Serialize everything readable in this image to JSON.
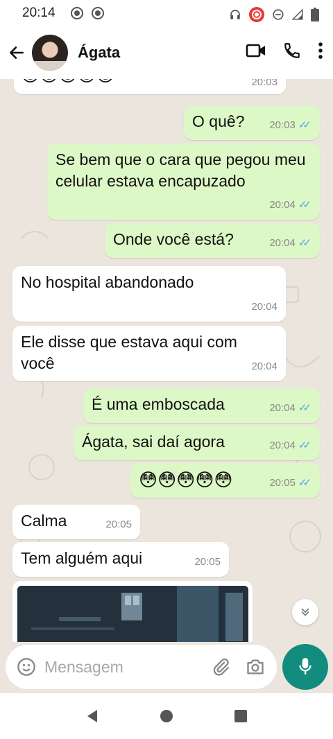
{
  "status_bar": {
    "time": "20:14",
    "left_icons": [
      "record-icon",
      "record-icon"
    ],
    "right_icons": [
      "headphones-icon",
      "recording-icon",
      "do-not-disturb-icon",
      "signal-icon",
      "battery-icon"
    ]
  },
  "header": {
    "contact_name": "Ágata",
    "actions": [
      "video-call-icon",
      "phone-icon",
      "more-icon"
    ]
  },
  "messages": [
    {
      "side": "in",
      "text": "😊😊😊😊😊",
      "time": "20:03"
    },
    {
      "side": "out",
      "text": "O quê?",
      "time": "20:03",
      "read": true
    },
    {
      "side": "out",
      "text": "Se bem que o cara que pegou meu celular estava encapuzado",
      "time": "20:04",
      "read": true
    },
    {
      "side": "out",
      "text": "Onde você está?",
      "time": "20:04",
      "read": true
    },
    {
      "side": "in",
      "text": "No hospital abandonado",
      "time": "20:04"
    },
    {
      "side": "in",
      "text": "Ele disse que estava aqui com você",
      "time": "20:04"
    },
    {
      "side": "out",
      "text": "É uma emboscada",
      "time": "20:04",
      "read": true
    },
    {
      "side": "out",
      "text": "Ágata, sai daí agora",
      "time": "20:04",
      "read": true
    },
    {
      "side": "out",
      "text": "😳😳😳😳😳",
      "time": "20:05",
      "read": true
    },
    {
      "side": "in",
      "text": "Calma",
      "time": "20:05"
    },
    {
      "side": "in",
      "text": "Tem alguém aqui",
      "time": "20:05"
    }
  ],
  "composer": {
    "placeholder": "Mensagem"
  },
  "colors": {
    "incoming": "#ffffff",
    "outgoing": "#dcf8c6",
    "chat_bg": "#ece5dd",
    "accent": "#128c7e",
    "read_ticks": "#4fa6e8"
  }
}
